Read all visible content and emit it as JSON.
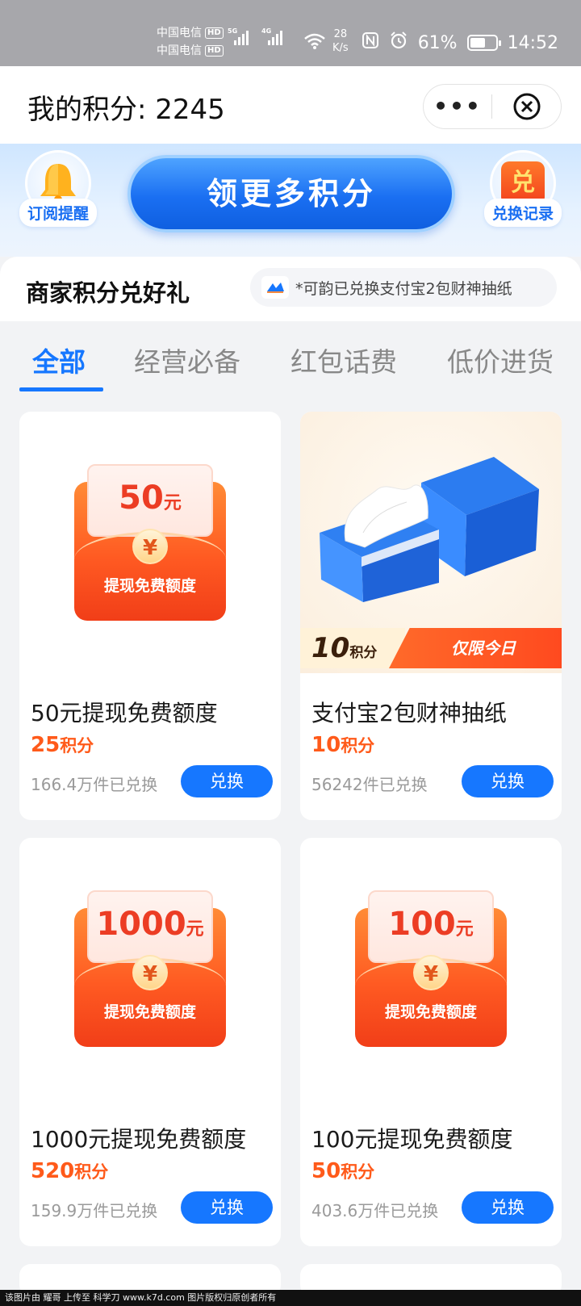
{
  "status_bar": {
    "carrier_1": "中国电信",
    "carrier_2": "中国电信",
    "hd": "HD",
    "net_1": "5G",
    "net_2": "4G",
    "speed_value": "28",
    "speed_unit": "K/s",
    "battery": "61%",
    "time": "14:52",
    "battery_level": 0.61
  },
  "title_bar": {
    "title": "我的积分: 2245",
    "more": "•••"
  },
  "banner": {
    "subscribe_label": "订阅提醒",
    "main_cta": "领更多积分",
    "exchange_icon_text": "兑",
    "records_label": "兑换记录"
  },
  "section": {
    "title": "商家积分兑好礼",
    "ticker": "*可韵已兑换支付宝2包财神抽纸"
  },
  "tabs": [
    {
      "label": "全部",
      "active": true
    },
    {
      "label": "经营必备",
      "active": false
    },
    {
      "label": "红包话费",
      "active": false
    },
    {
      "label": "低价进货",
      "active": false
    }
  ],
  "products": [
    {
      "name": "50元提现免费额度",
      "points": "25",
      "points_unit": "积分",
      "sold": "166.4万件已兑换",
      "button": "兑换",
      "env_amount": "50",
      "env_unit": "元",
      "env_symbol": "¥",
      "env_caption": "提现免费额度"
    },
    {
      "name": "支付宝2包财神抽纸",
      "points": "10",
      "points_unit": "积分",
      "sold": "56242件已兑换",
      "button": "兑换",
      "promo_points": "10",
      "promo_unit": "积分",
      "promo_tag": "仅限今日"
    },
    {
      "name": "1000元提现免费额度",
      "points": "520",
      "points_unit": "积分",
      "sold": "159.9万件已兑换",
      "button": "兑换",
      "env_amount": "1000",
      "env_unit": "元",
      "env_symbol": "¥",
      "env_caption": "提现免费额度"
    },
    {
      "name": "100元提现免费额度",
      "points": "50",
      "points_unit": "积分",
      "sold": "403.6万件已兑换",
      "button": "兑换",
      "env_amount": "100",
      "env_unit": "元",
      "env_symbol": "¥",
      "env_caption": "提现免费额度"
    }
  ],
  "footer": {
    "watermark": "该图片由 耀哥 上传至 科学刀 www.k7d.com 图片版权归原创者所有"
  },
  "colors": {
    "accent": "#1677ff",
    "points": "#ff5a1a",
    "envelope": "#ff5a22"
  }
}
